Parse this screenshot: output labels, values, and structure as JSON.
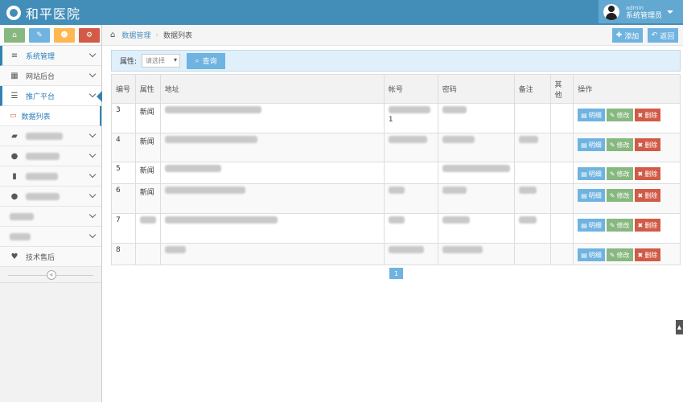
{
  "app": {
    "title": "和平医院",
    "user_small": "admin",
    "user_role": "系统管理员"
  },
  "shortcuts": [
    {
      "icon": "home-icon",
      "glyph": "⌂",
      "color": "#87b87f"
    },
    {
      "icon": "pencil-icon",
      "glyph": "✎",
      "color": "#6fb3e0"
    },
    {
      "icon": "users-icon",
      "glyph": "☻",
      "color": "#ffb752"
    },
    {
      "icon": "share-icon",
      "glyph": "⚙",
      "color": "#d15b47"
    }
  ],
  "sidebar": {
    "items": [
      {
        "label": "系统管理",
        "icon": "list-icon",
        "glyph": "≡"
      },
      {
        "label": "网站后台",
        "icon": "grid-icon",
        "glyph": "▦"
      },
      {
        "label": "推广平台",
        "icon": "list-icon",
        "glyph": "☰"
      },
      {
        "label": "数据列表",
        "icon": "desktop-icon",
        "glyph": "▭"
      },
      {
        "label": "技术售后",
        "icon": "heart-icon",
        "glyph": "♥"
      }
    ]
  },
  "breadcrumb": {
    "parent": "数据管理",
    "current": "数据列表"
  },
  "actions": {
    "add": "添加",
    "back": "返回"
  },
  "filter": {
    "label": "属性:",
    "placeholder": "请选择",
    "query": "查询"
  },
  "table": {
    "headers": [
      "编号",
      "属性",
      "地址",
      "帐号",
      "密码",
      "备注",
      "其他",
      "操作"
    ],
    "rows": [
      {
        "id": "3",
        "type": "新闻",
        "account_extra": "1"
      },
      {
        "id": "4",
        "type": "新闻",
        "account_extra": ""
      },
      {
        "id": "5",
        "type": "新闻",
        "account_extra": ""
      },
      {
        "id": "6",
        "type": "新闻",
        "account_extra": ""
      },
      {
        "id": "7",
        "type": "",
        "account_extra": ""
      },
      {
        "id": "8",
        "type": "",
        "account_extra": ""
      }
    ],
    "row_actions": {
      "view": "明细",
      "edit": "修改",
      "delete": "删除"
    }
  },
  "pager": {
    "current": "1"
  }
}
